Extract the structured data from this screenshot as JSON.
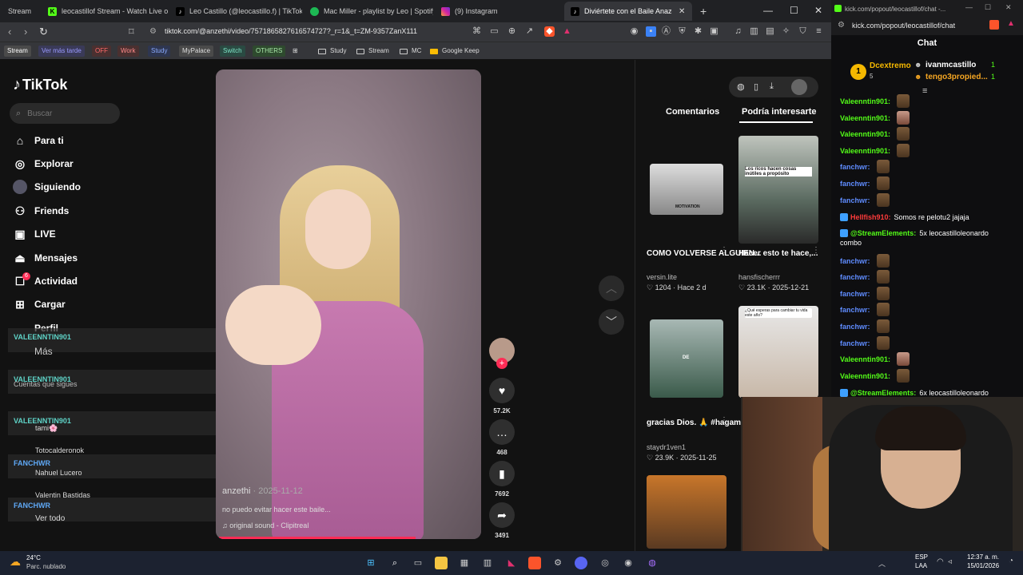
{
  "browser": {
    "tabs": [
      {
        "label": "Stream",
        "icon": "stream-tab-icon"
      },
      {
        "label": "leocastillof Stream - Watch Live o",
        "icon": "kick-icon"
      },
      {
        "label": "Leo Castillo (@leocastillo.f) | TikTok",
        "icon": "tiktok-icon"
      },
      {
        "label": "Mac Miller - playlist by Leo | Spotify",
        "icon": "spotify-icon"
      },
      {
        "label": "(9) Instagram",
        "icon": "instagram-icon"
      },
      {
        "label": "Diviértete con el Baile Anazet",
        "icon": "tiktok-icon"
      }
    ],
    "new_tab": "+",
    "url": "tiktok.com/@anzethi/video/7571865827616574727?_r=1&_t=ZM-9357ZanX111",
    "bookmarks": [
      {
        "label": "Stream",
        "color": "#555555"
      },
      {
        "label": "Ver más tarde",
        "color": "#6b6bd6"
      },
      {
        "label": "OFF",
        "color": "#ff6a6a"
      },
      {
        "label": "Work",
        "color": "#ff8a8a"
      },
      {
        "label": "Study",
        "color": "#8aaaff"
      },
      {
        "label": "MyPalace",
        "color": "#dddddd"
      },
      {
        "label": "Switch",
        "color": "#7ee6c8"
      },
      {
        "label": "OTHERS",
        "color": "#a8e6a8"
      }
    ],
    "bookmark_folders": [
      "Study",
      "Stream",
      "MC",
      "Google Keep"
    ]
  },
  "tiktok": {
    "logo": "TikTok",
    "search_placeholder": "Buscar",
    "nav": [
      "Para ti",
      "Explorar",
      "Siguiendo",
      "Friends",
      "LIVE",
      "Mensajes",
      "Actividad",
      "Cargar",
      "Perfil",
      "Más"
    ],
    "activity_badge": "6",
    "following_label": "Cuentas que sigues",
    "following": [
      "tami🌸",
      "Totocalderonok",
      "Nahuel Lucero",
      "Valentin Bastidas"
    ],
    "see_all": "Ver todo",
    "video": {
      "username": "anzethi",
      "date": "· 2025-11-12",
      "description": "no puedo evitar hacer este baile...",
      "sound": "original sound - Clipitreal",
      "progress": 0.74
    },
    "actions": {
      "likes": "57.2K",
      "comments": "468",
      "saves": "7692",
      "shares": "3491"
    },
    "tabs": [
      "Comentarios",
      "Podría interesarte"
    ],
    "recommended": [
      {
        "title": "COMO VOLVERSE ALGUIEN...",
        "user": "versin.lite",
        "stats": "♡ 1204 · Hace 2 d",
        "thumb_text": "MOTIVATION"
      },
      {
        "title": "Hacer esto te hace,...",
        "user": "hansfischerrr",
        "stats": "♡ 23.1K · 2025-12-21",
        "thumb_text": "Los ricos hacen cosas inútiles a propósito"
      },
      {
        "title": "gracias Dios. 🙏 #hagamosviralaj...",
        "user": "staydr1ven1",
        "stats": "♡ 23.9K · 2025-11-25",
        "thumb_text": "DE"
      },
      {
        "title": "¿Qué esperas para cambiar tu vida este año?",
        "user": "",
        "stats": "",
        "thumb_text": "¿Qué esperas para cambiar tu vida este año?"
      }
    ]
  },
  "overlay_chat": {
    "names": [
      "VALEENNTIN901",
      "VALEENNTIN901",
      "VALEENNTIN901",
      "FANCHWR",
      "FANCHWR"
    ]
  },
  "kick": {
    "tab_title": "kick.com/popout/leocastillof/chat -...",
    "url": "kick.com/popout/leocastillof/chat",
    "chat_title": "Chat",
    "leaderboard": [
      {
        "rank": "1",
        "name": "Dcextremo",
        "count": "5"
      },
      {
        "name": "ivanmcastillo",
        "count": "1"
      },
      {
        "name": "tengo3propied...",
        "count": "1"
      }
    ],
    "messages": [
      {
        "user": "Valeenntin901:",
        "text": "",
        "color": "green"
      },
      {
        "user": "Valeenntin901:",
        "text": "",
        "color": "green"
      },
      {
        "user": "Valeenntin901:",
        "text": "",
        "color": "green"
      },
      {
        "user": "Valeenntin901:",
        "text": "",
        "color": "green"
      },
      {
        "user": "fanchwr:",
        "text": "",
        "color": "blue"
      },
      {
        "user": "fanchwr:",
        "text": "",
        "color": "blue"
      },
      {
        "user": "fanchwr:",
        "text": "",
        "color": "blue"
      },
      {
        "user": "Hellfish910:",
        "text": "Somos re pelotu2 jajaja",
        "color": "red"
      },
      {
        "user": "@StreamElements:",
        "text": "5x leocastilloleonardo",
        "text2": "combo",
        "color": "se"
      },
      {
        "user": "fanchwr:",
        "text": "",
        "color": "blue"
      },
      {
        "user": "fanchwr:",
        "text": "",
        "color": "blue"
      },
      {
        "user": "fanchwr:",
        "text": "",
        "color": "blue"
      },
      {
        "user": "fanchwr:",
        "text": "",
        "color": "blue"
      },
      {
        "user": "fanchwr:",
        "text": "",
        "color": "blue"
      },
      {
        "user": "fanchwr:",
        "text": "",
        "color": "blue"
      },
      {
        "user": "Valeenntin901:",
        "text": "",
        "color": "green"
      },
      {
        "user": "Valeenntin901:",
        "text": "",
        "color": "green"
      },
      {
        "user": "@StreamElements:",
        "text": "6x leocastilloleonardo",
        "color": "se"
      }
    ]
  },
  "taskbar": {
    "weather_temp": "24°C",
    "weather_desc": "Parc. nublado",
    "lang": "ESP",
    "lang2": "LAA",
    "time": "12:37 a. m.",
    "date": "15/01/2026"
  }
}
